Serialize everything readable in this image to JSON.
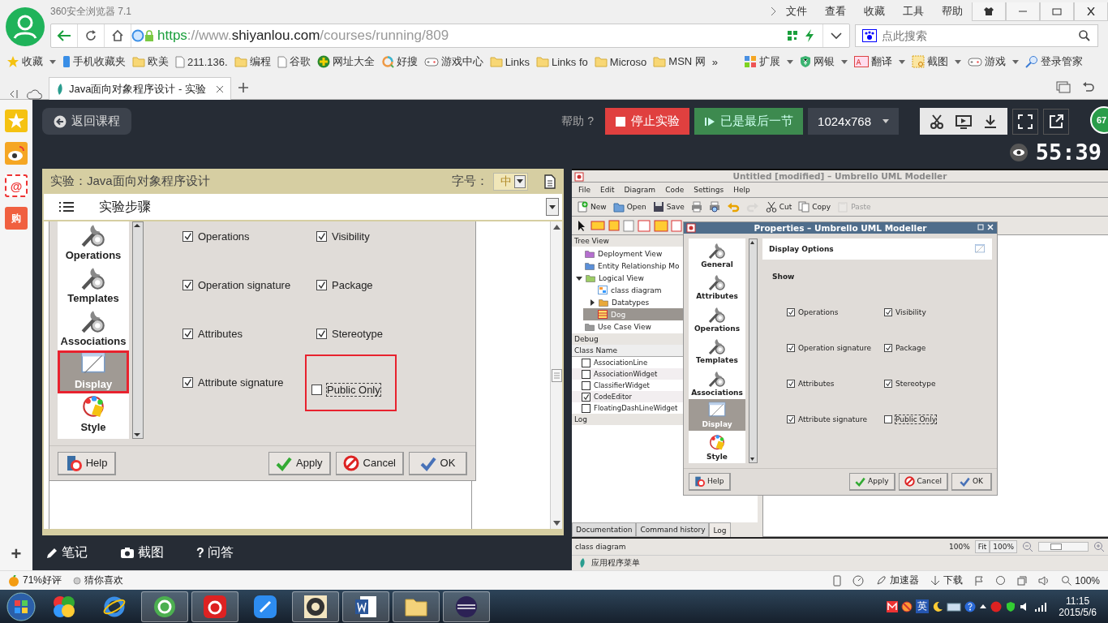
{
  "browser": {
    "app_title": "360安全浏览器 7.1",
    "menu": [
      "文件",
      "查看",
      "收藏",
      "工具",
      "帮助"
    ],
    "address": [
      {
        "kind": "scheme",
        "text": "https"
      },
      {
        "kind": "dim",
        "text": "://www."
      },
      {
        "kind": "host",
        "text": "shiyanlou.com"
      },
      {
        "kind": "dim",
        "text": "/courses/running/809"
      }
    ],
    "search": {
      "placeholder": "点此搜索"
    },
    "bookmarks": [
      {
        "kind": "star",
        "label": "收藏",
        "menu": true
      },
      {
        "kind": "phone",
        "label": "手机收藏夹",
        "menu": false
      },
      {
        "kind": "folder",
        "label": "欧美",
        "menu": false
      },
      {
        "kind": "page",
        "label": "211.136.",
        "menu": false
      },
      {
        "kind": "folder",
        "label": "编程",
        "menu": false
      },
      {
        "kind": "page",
        "label": "谷歌",
        "menu": false
      },
      {
        "kind": "globe",
        "label": "网址大全",
        "menu": false
      },
      {
        "kind": "ring",
        "label": "好搜",
        "menu": false
      },
      {
        "kind": "gamepad",
        "label": "游戏中心",
        "menu": false
      },
      {
        "kind": "folder",
        "label": "Links",
        "menu": false
      },
      {
        "kind": "folder",
        "label": "Links fo",
        "menu": false
      },
      {
        "kind": "folder",
        "label": "Microso",
        "menu": false
      },
      {
        "kind": "folder",
        "label": "MSN 网",
        "menu": false
      }
    ],
    "overflow": "»",
    "extensions": [
      {
        "kind": "grid",
        "label": "扩展",
        "menu": true
      },
      {
        "kind": "shield",
        "label": "网银",
        "menu": true
      },
      {
        "kind": "translate",
        "label": "翻译",
        "menu": true
      },
      {
        "kind": "capture",
        "label": "截图",
        "menu": true
      },
      {
        "kind": "gamepad",
        "label": "游戏",
        "menu": true
      },
      {
        "kind": "key",
        "label": "登录管家",
        "menu": false
      }
    ],
    "tabs": [
      {
        "label": "Java面向对象程序设计 - 实验",
        "selected": true
      }
    ]
  },
  "site": {
    "back": "返回课程",
    "help": "帮助 ?",
    "stop": "停止实验",
    "last": "已是最后一节",
    "resolution": "1024x768",
    "timer": "55:39",
    "badge": "67"
  },
  "sidebar": [
    {
      "kind": "star"
    },
    {
      "kind": "weibo"
    },
    {
      "kind": "mail",
      "glyph": "@"
    },
    {
      "kind": "shop",
      "glyph": "购"
    },
    {
      "kind": "add",
      "glyph": "+"
    }
  ],
  "experiment": {
    "title": "实验：Java面向对象程序设计",
    "font_label": "字号：",
    "font_size": "中",
    "steps": "实验步骤",
    "screenshot": {
      "sidebar": [
        {
          "label": "Operations",
          "kind": "wrench",
          "selected": false,
          "highlighted": false
        },
        {
          "label": "Templates",
          "kind": "wrench",
          "selected": false,
          "highlighted": false
        },
        {
          "label": "Associations",
          "kind": "wrench",
          "selected": false,
          "highlighted": false
        },
        {
          "label": "Display",
          "kind": "display",
          "selected": true,
          "highlighted": true
        },
        {
          "label": "Style",
          "kind": "palette",
          "selected": false,
          "highlighted": false
        }
      ],
      "options": [
        {
          "label": "Operations",
          "checked": true,
          "focused": false,
          "highlighted": false
        },
        {
          "label": "Visibility",
          "checked": true,
          "focused": false,
          "highlighted": false
        },
        {
          "label": "Operation signature",
          "checked": true,
          "focused": false,
          "highlighted": false
        },
        {
          "label": "Package",
          "checked": true,
          "focused": false,
          "highlighted": false
        },
        {
          "label": "Attributes",
          "checked": true,
          "focused": false,
          "highlighted": false
        },
        {
          "label": "Stereotype",
          "checked": true,
          "focused": false,
          "highlighted": false
        },
        {
          "label": "Attribute signature",
          "checked": true,
          "focused": false,
          "highlighted": false
        },
        {
          "label": "Public Only",
          "checked": false,
          "focused": true,
          "highlighted": true
        }
      ],
      "buttons": [
        {
          "kind": "help",
          "label": "Help"
        },
        {
          "kind": "apply",
          "label": "Apply"
        },
        {
          "kind": "cancel",
          "label": "Cancel"
        },
        {
          "kind": "ok",
          "label": "OK"
        }
      ]
    },
    "tools": [
      {
        "kind": "note",
        "label": "笔记"
      },
      {
        "kind": "camera",
        "label": "截图"
      },
      {
        "kind": "question",
        "glyph": "?",
        "label": "问答"
      }
    ]
  },
  "vm": {
    "title": "Untitled [modified] – Umbrello UML Modeller",
    "menu": [
      "File",
      "Edit",
      "Diagram",
      "Code",
      "Settings",
      "Help"
    ],
    "toolbar": [
      {
        "kind": "new",
        "label": "New",
        "disabled": false
      },
      {
        "kind": "open",
        "label": "Open",
        "disabled": false
      },
      {
        "kind": "save",
        "label": "Save",
        "disabled": false
      },
      {
        "kind": "print",
        "disabled": false
      },
      {
        "kind": "preview",
        "disabled": false
      },
      {
        "kind": "undo",
        "disabled": false
      },
      {
        "kind": "redo",
        "disabled": true
      },
      {
        "kind": "cut",
        "label": "Cut",
        "disabled": false
      },
      {
        "kind": "copy",
        "label": "Copy",
        "disabled": false
      },
      {
        "kind": "paste",
        "label": "Paste",
        "disabled": true
      }
    ],
    "tree_title": "Tree View",
    "tree": [
      {
        "label": "Deployment View",
        "kind": "deployment",
        "selected": false
      },
      {
        "label": "Entity Relationship Mo",
        "kind": "entity",
        "selected": false
      },
      {
        "label": "Logical View",
        "kind": "logical",
        "selected": false,
        "expanded": true,
        "children": [
          {
            "label": "class diagram",
            "kind": "diagram",
            "selected": false
          },
          {
            "label": "Datatypes",
            "kind": "folder",
            "selected": false,
            "expanded": false
          },
          {
            "label": "Dog",
            "kind": "class",
            "selected": true
          }
        ]
      },
      {
        "label": "Use Case View",
        "kind": "usecase",
        "selected": false
      }
    ],
    "debug_title": "Debug",
    "debug_column": "Class Name",
    "debug": [
      {
        "label": "AssociationLine",
        "checked": false
      },
      {
        "label": "AssociationWidget",
        "checked": false
      },
      {
        "label": "ClassifierWidget",
        "checked": false
      },
      {
        "label": "CodeEditor",
        "checked": true
      },
      {
        "label": "FloatingDashLineWidget",
        "checked": false
      }
    ],
    "log_title": "Log",
    "tabs": [
      {
        "label": "Documentation",
        "selected": false
      },
      {
        "label": "Command history",
        "selected": false
      },
      {
        "label": "Log",
        "selected": true
      }
    ],
    "status": "class diagram",
    "zoom_text": "100%",
    "fit": "Fit",
    "zoom_button": "100%",
    "zoom": {
      "level": 0.3
    },
    "panel": "应用程序菜单",
    "properties": {
      "title": "Properties – Umbrello UML Modeller",
      "header": "Display Options",
      "section": "Show",
      "sidebar": [
        {
          "label": "General",
          "kind": "wrench",
          "selected": false
        },
        {
          "label": "Attributes",
          "kind": "wrench",
          "selected": false
        },
        {
          "label": "Operations",
          "kind": "wrench",
          "selected": false
        },
        {
          "label": "Templates",
          "kind": "wrench",
          "selected": false
        },
        {
          "label": "Associations",
          "kind": "wrench",
          "selected": false
        },
        {
          "label": "Display",
          "kind": "display",
          "selected": true
        },
        {
          "label": "Style",
          "kind": "palette",
          "selected": false
        }
      ],
      "options": [
        {
          "label": "Operations",
          "checked": true,
          "focused": false
        },
        {
          "label": "Visibility",
          "checked": true,
          "focused": false
        },
        {
          "label": "Operation signature",
          "checked": true,
          "focused": false
        },
        {
          "label": "Package",
          "checked": true,
          "focused": false
        },
        {
          "label": "Attributes",
          "checked": true,
          "focused": false
        },
        {
          "label": "Stereotype",
          "checked": true,
          "focused": false
        },
        {
          "label": "Attribute signature",
          "checked": true,
          "focused": false
        },
        {
          "label": "Public Only",
          "checked": false,
          "focused": true
        }
      ],
      "buttons": [
        {
          "kind": "help",
          "label": "Help"
        },
        {
          "kind": "apply",
          "label": "Apply"
        },
        {
          "kind": "cancel",
          "label": "Cancel"
        },
        {
          "kind": "ok",
          "label": "OK"
        }
      ]
    }
  },
  "status_bar": {
    "rating": "71%好评",
    "recommend": "猜你喜欢",
    "right": [
      {
        "kind": "speed",
        "label": "加速器"
      },
      {
        "kind": "download",
        "label": "下载"
      },
      {
        "kind": "zoom",
        "label": "100%"
      }
    ]
  },
  "taskbar": {
    "apps": [
      {
        "kind": "pinwheel",
        "open": false
      },
      {
        "kind": "ie",
        "open": false
      },
      {
        "kind": "browser",
        "open": true
      },
      {
        "kind": "netease",
        "open": true
      },
      {
        "kind": "feather",
        "open": false
      },
      {
        "kind": "game",
        "open": true
      },
      {
        "kind": "word",
        "open": true
      },
      {
        "kind": "explorer",
        "open": true
      },
      {
        "kind": "eclipse",
        "open": true
      }
    ],
    "ime": "英",
    "time": "11:15",
    "date": "2015/5/6"
  }
}
